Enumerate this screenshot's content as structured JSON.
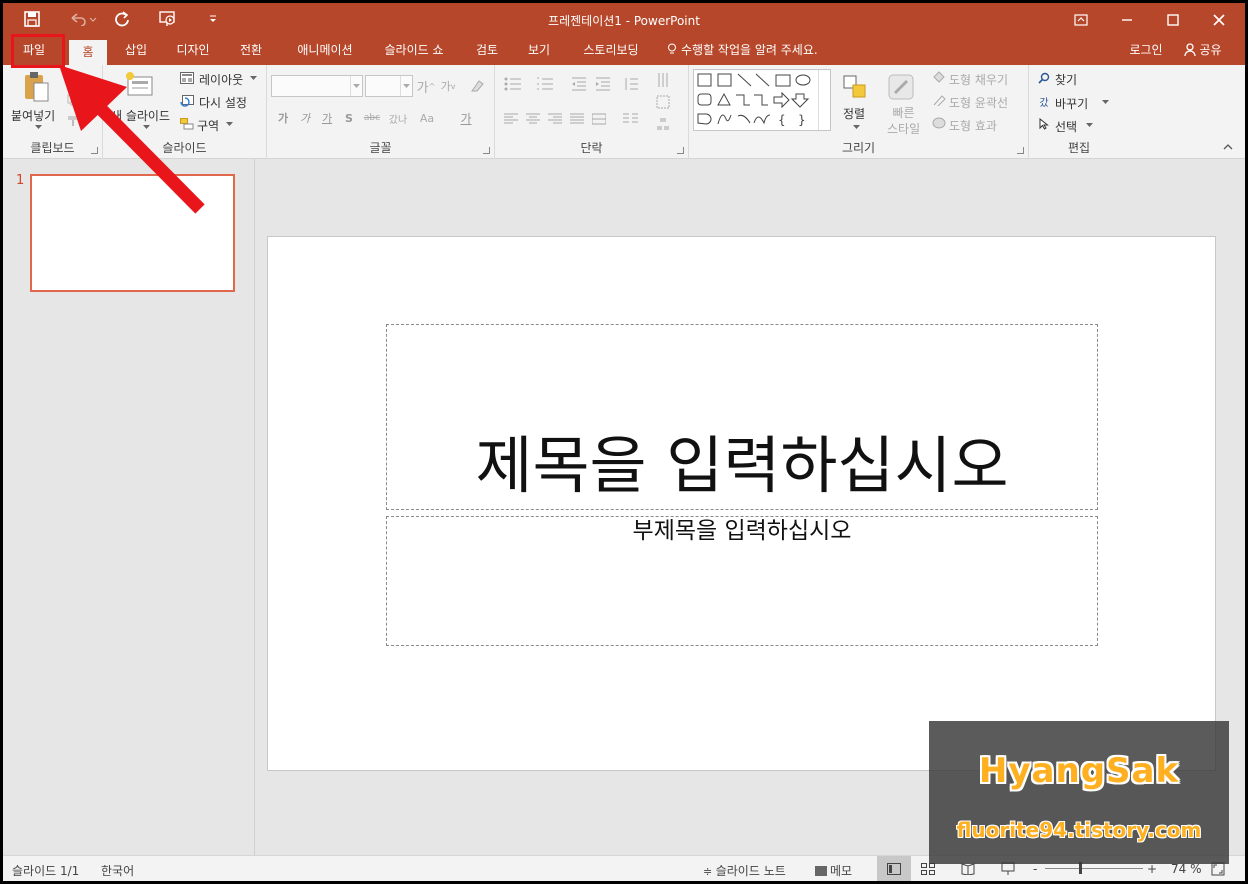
{
  "window": {
    "title": "프레젠테이션1 - PowerPoint",
    "accent_color": "#b7472a",
    "quick_access": [
      "save-icon",
      "undo-icon",
      "redo-icon",
      "slideshow-icon",
      "customize-icon"
    ],
    "controls": [
      "ribbon-display-icon",
      "minimize-icon",
      "maximize-icon",
      "close-icon"
    ]
  },
  "tabs": [
    "파일",
    "홈",
    "삽입",
    "디자인",
    "전환",
    "애니메이션",
    "슬라이드 쇼",
    "검토",
    "보기",
    "스토리보딩"
  ],
  "active_tab": "홈",
  "tell_me": "수행할 작업을 알려 주세요.",
  "login": "로그인",
  "share": "공유",
  "ribbon": {
    "clipboard": {
      "label": "클립보드",
      "paste": "붙여넣기"
    },
    "slides": {
      "label": "슬라이드",
      "new_slide": "새 슬라이드",
      "layout": "레이아웃",
      "reset": "다시 설정",
      "section": "구역"
    },
    "font": {
      "label": "글꼴",
      "font_name": "",
      "font_size": "",
      "bold": "가",
      "italic": "가",
      "underline": "가",
      "shadow": "S",
      "strike": "abc",
      "spacing": "갔나",
      "case": "Aa",
      "color": "가"
    },
    "paragraph": {
      "label": "단락"
    },
    "drawing": {
      "label": "그리기",
      "arrange": "정렬",
      "quick_styles": "빠른\n스타일",
      "fill": "도형 채우기",
      "outline": "도형 윤곽선",
      "effects": "도형 효과"
    },
    "editing": {
      "label": "편집",
      "find": "찾기",
      "replace": "바꾸기",
      "select": "선택"
    }
  },
  "thumbnails": [
    {
      "number": "1"
    }
  ],
  "slide": {
    "title_placeholder": "제목을 입력하십시오",
    "subtitle_placeholder": "부제목을 입력하십시오"
  },
  "status": {
    "slide_counter": "슬라이드 1/1",
    "language": "한국어",
    "notes": "슬라이드 노트",
    "comments": "메모",
    "zoom_minus": "-",
    "zoom_plus": "+",
    "zoom": "74 %"
  },
  "watermark": {
    "name": "HyangSak",
    "url": "fluorite94.tistory.com"
  },
  "annotation": {
    "highlight_color": "#e8151b"
  }
}
